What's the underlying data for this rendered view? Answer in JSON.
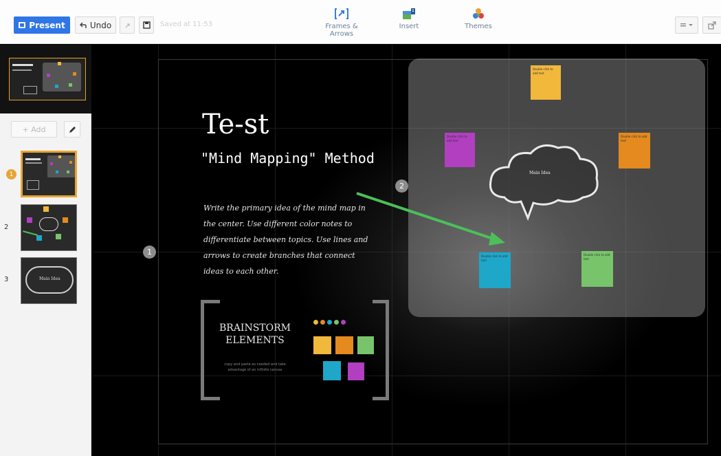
{
  "toolbar": {
    "present_label": "Present",
    "undo_label": "Undo",
    "save_status": "Saved at 11:53",
    "frames_label": "Frames & Arrows",
    "insert_label": "Insert",
    "themes_label": "Themes"
  },
  "sidebar": {
    "add_label": "+ Add",
    "thumbnails": [
      {
        "number": "1"
      },
      {
        "number": "2"
      },
      {
        "number": "3"
      }
    ],
    "thumb_3_text": "Main Idea"
  },
  "slide": {
    "title": "Te-st",
    "subtitle": "\"Mind Mapping\" Method",
    "body": "Write the primary idea of the mind map in the center. Use different color notes to differentiate between topics. Use lines and arrows to create branches that connect ideas to each other.",
    "step_1": "1",
    "step_2": "2",
    "brainstorm_line1": "BRAINSTORM",
    "brainstorm_line2": "ELEMENTS",
    "brainstorm_caption": "copy and paste as needed and take advantage of an infinite canvas",
    "cloud_label": "Main Idea",
    "note_text": "Double click to add text"
  },
  "colors": {
    "accent": "#2f76e6",
    "orange_highlight": "#e8a534",
    "arrow": "#4cbf5a",
    "note_yellow": "#f1b83c",
    "note_orange": "#e48a1e",
    "note_purple": "#b13fc0",
    "note_cyan": "#1ea7c9",
    "note_green": "#78c46b"
  }
}
